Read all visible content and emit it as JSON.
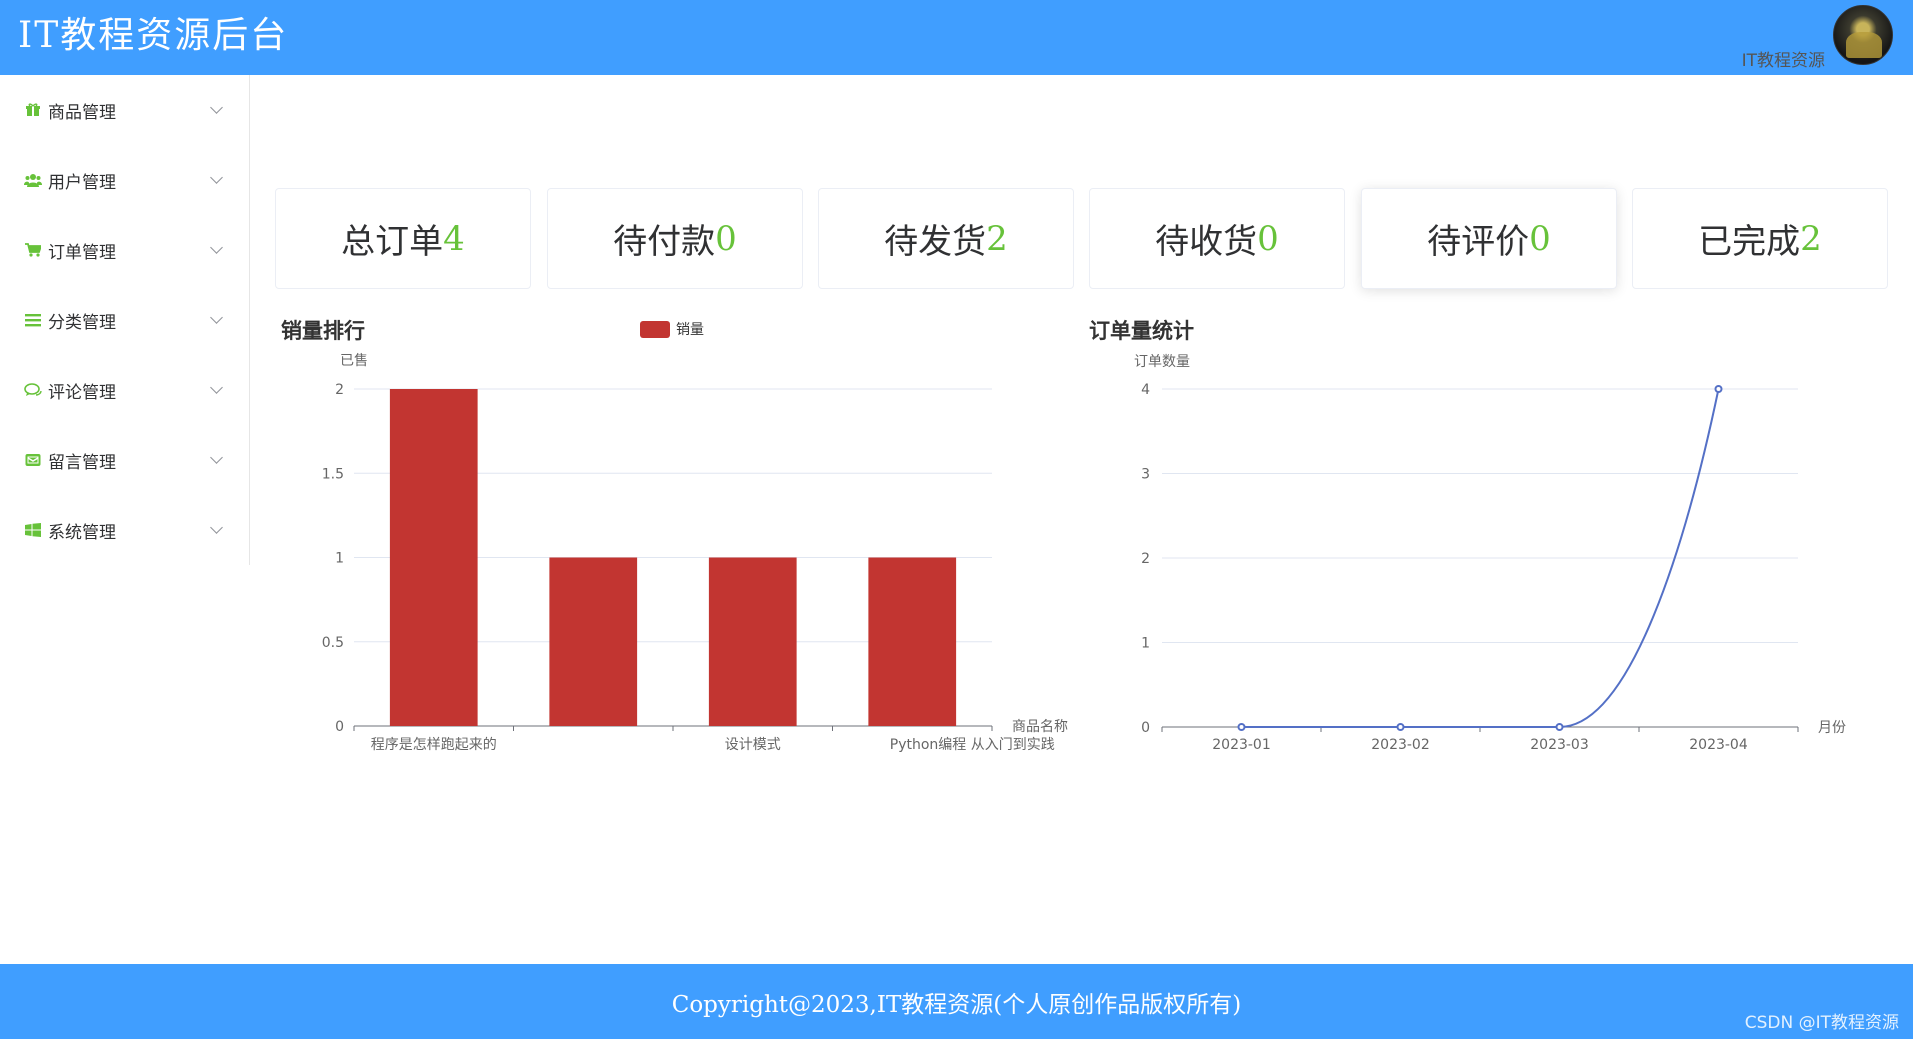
{
  "header": {
    "title": "IT教程资源后台",
    "user": "IT教程资源"
  },
  "sidebar": {
    "items": [
      {
        "label": "商品管理",
        "icon": "gift-icon"
      },
      {
        "label": "用户管理",
        "icon": "users-icon"
      },
      {
        "label": "订单管理",
        "icon": "cart-icon"
      },
      {
        "label": "分类管理",
        "icon": "list-icon"
      },
      {
        "label": "评论管理",
        "icon": "comments-icon"
      },
      {
        "label": "留言管理",
        "icon": "envelope-icon"
      },
      {
        "label": "系统管理",
        "icon": "windows-icon"
      }
    ]
  },
  "stats": [
    {
      "label": "总订单",
      "value": "4"
    },
    {
      "label": "待付款",
      "value": "0"
    },
    {
      "label": "待发货",
      "value": "2"
    },
    {
      "label": "待收货",
      "value": "0"
    },
    {
      "label": "待评价",
      "value": "0"
    },
    {
      "label": "已完成",
      "value": "2"
    }
  ],
  "colors": {
    "brand": "#409eff",
    "accent_green": "#67c23a",
    "bar": "#c23531",
    "line": "#5470c6"
  },
  "chart_data": [
    {
      "type": "bar",
      "title": "销量排行",
      "legend": [
        "销量"
      ],
      "legend_position": "top-center",
      "xlabel": "商品名称",
      "ylabel": "已售",
      "categories": [
        "程序是怎样跑起来的",
        "",
        "设计模式",
        "Python编程 从入门到实践"
      ],
      "x_tick_labels": [
        "程序是怎样跑起来的",
        "设计模式",
        "Python编程 从入门到实践"
      ],
      "series": [
        {
          "name": "销量",
          "values": [
            2,
            1,
            1,
            1
          ]
        }
      ],
      "ylim": [
        0,
        2
      ],
      "yticks": [
        "0",
        "0.5",
        "1",
        "1.5",
        "2"
      ],
      "grid": true
    },
    {
      "type": "line",
      "title": "订单量统计",
      "xlabel": "月份",
      "ylabel": "订单数量",
      "categories": [
        "2023-01",
        "2023-02",
        "2023-03",
        "2023-04"
      ],
      "series": [
        {
          "values": [
            0,
            0,
            0,
            4
          ]
        }
      ],
      "ylim": [
        0,
        4
      ],
      "yticks": [
        "0",
        "1",
        "2",
        "3",
        "4"
      ],
      "smooth": true,
      "grid": true
    }
  ],
  "footer": {
    "copyright": "Copyright@2023,IT教程资源(个人原创作品版权所有)",
    "watermark": "CSDN @IT教程资源"
  }
}
